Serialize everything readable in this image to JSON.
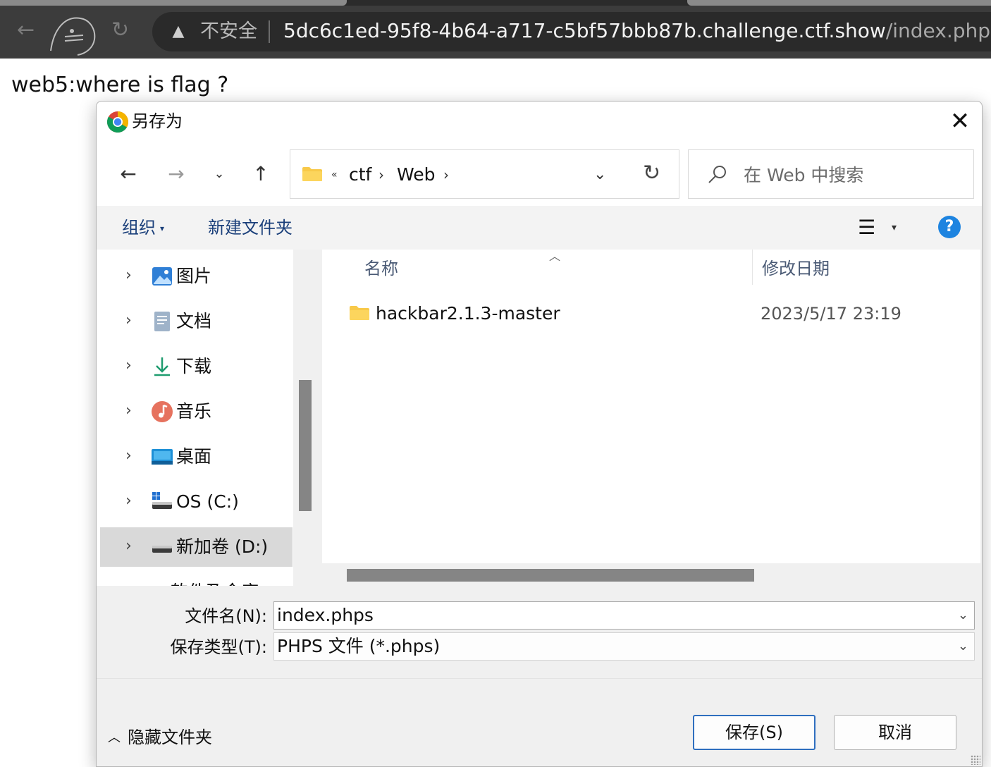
{
  "browser": {
    "security_label": "不安全",
    "url_host": "5dc6c1ed-95f8-4b64-a717-c5bf57bbb87b.challenge.ctf.show",
    "url_path": "/index.php"
  },
  "page": {
    "heading": "web5:where is flag ?"
  },
  "dialog": {
    "title": "另存为",
    "breadcrumb": {
      "overflow": "«",
      "items": [
        "ctf",
        "Web"
      ]
    },
    "search_placeholder": "在 Web 中搜索",
    "toolbar": {
      "organize": "组织",
      "new_folder": "新建文件夹"
    },
    "nav_items": [
      {
        "label": "图片",
        "icon": "pictures-icon"
      },
      {
        "label": "文档",
        "icon": "documents-icon"
      },
      {
        "label": "下载",
        "icon": "downloads-icon"
      },
      {
        "label": "音乐",
        "icon": "music-icon"
      },
      {
        "label": "桌面",
        "icon": "desktop-icon"
      },
      {
        "label": "OS (C:)",
        "icon": "system-drive-icon"
      },
      {
        "label": "新加卷 (D:)",
        "icon": "drive-icon",
        "selected": true
      },
      {
        "label": "软件及金库 (E:)",
        "icon": "drive-icon"
      }
    ],
    "columns": {
      "name": "名称",
      "modified": "修改日期"
    },
    "files": [
      {
        "name": "hackbar2.1.3-master",
        "modified": "2023/5/17 23:19",
        "type": "folder"
      }
    ],
    "filename_label": "文件名(N):",
    "filename_value": "index.phps",
    "filetype_label": "保存类型(T):",
    "filetype_value": "PHPS 文件 (*.phps)",
    "hide_folders": "隐藏文件夹",
    "save_button": "保存(S)",
    "cancel_button": "取消"
  },
  "colors": {
    "chrome_bg": "#3c3c3c",
    "accent": "#1e84e0",
    "folder": "#f8c949"
  }
}
